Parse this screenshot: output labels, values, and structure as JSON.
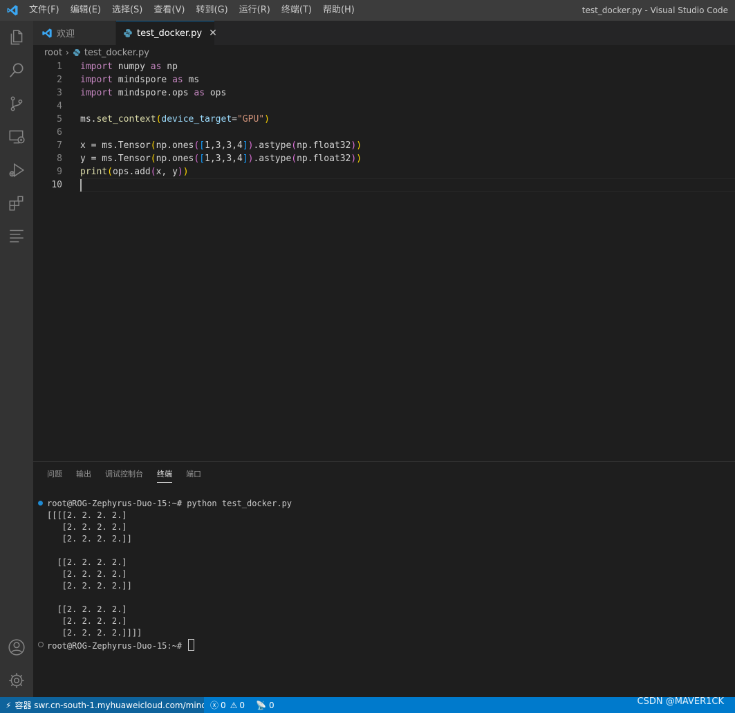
{
  "window_title": "test_docker.py - Visual Studio Code",
  "menu": [
    "文件(F)",
    "编辑(E)",
    "选择(S)",
    "查看(V)",
    "转到(G)",
    "运行(R)",
    "终端(T)",
    "帮助(H)"
  ],
  "activity_icons": [
    "explorer-icon",
    "search-icon",
    "source-control-icon",
    "remote-explorer-icon",
    "run-debug-icon",
    "extensions-icon",
    "outline-icon",
    "accounts-icon",
    "manage-gear-icon"
  ],
  "tabs": [
    {
      "label": "欢迎",
      "active": false
    },
    {
      "label": "test_docker.py",
      "active": true,
      "close": "✕"
    }
  ],
  "breadcrumb": {
    "root": "root",
    "file": "test_docker.py"
  },
  "code": {
    "line_numbers": [
      "1",
      "2",
      "3",
      "4",
      "5",
      "6",
      "7",
      "8",
      "9",
      "10"
    ],
    "current_line": "10"
  },
  "panel": {
    "tabs": [
      "问题",
      "输出",
      "调试控制台",
      "终端",
      "端口"
    ],
    "active_tab": "终端",
    "terminal": {
      "prompt": "root@ROG-Zephyrus-Duo-15:~# ",
      "command": "python test_docker.py",
      "output": "[[[[2. 2. 2. 2.]\n   [2. 2. 2. 2.]\n   [2. 2. 2. 2.]]\n\n  [[2. 2. 2. 2.]\n   [2. 2. 2. 2.]\n   [2. 2. 2. 2.]]\n\n  [[2. 2. 2. 2.]\n   [2. 2. 2. 2.]\n   [2. 2. 2. 2.]]]]",
      "prompt2": "root@ROG-Zephyrus-Duo-15:~# "
    }
  },
  "statusbar": {
    "remote": "容器 swr.cn-south-1.myhuaweicloud.com/mind...",
    "errors": "0",
    "warnings": "0",
    "ports": "0"
  },
  "watermark": "CSDN @MAVER1CK",
  "colors": {
    "accent": "#007acc",
    "keyword": "#c586c0",
    "string": "#ce9178",
    "number": "#b5cea8",
    "function": "#dcdcaa",
    "variable": "#9cdcfe"
  }
}
